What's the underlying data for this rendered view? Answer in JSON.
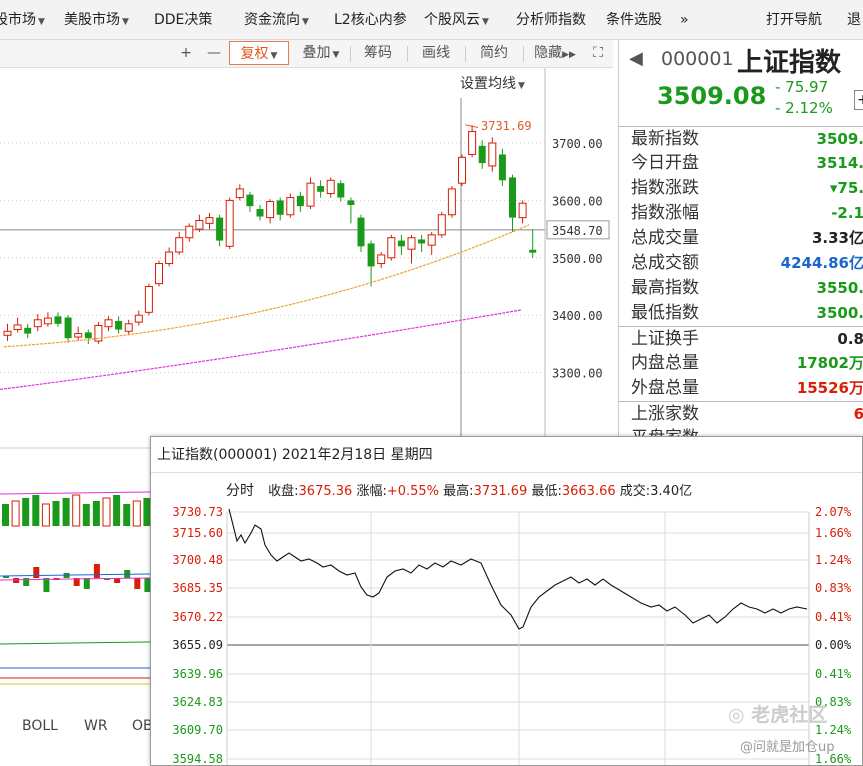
{
  "menu": [
    {
      "label": "股市场",
      "caret": true
    },
    {
      "label": "美股市场",
      "caret": true
    },
    {
      "label": "DDE决策",
      "caret": false
    },
    {
      "label": "资金流向",
      "caret": true
    },
    {
      "label": "L2核心内参",
      "caret": false
    },
    {
      "label": "个股风云",
      "caret": true
    },
    {
      "label": "分析师指数",
      "caret": false
    },
    {
      "label": "条件选股",
      "caret": false
    },
    {
      "label": "»",
      "caret": false
    },
    {
      "label": "打开导航",
      "caret": false
    },
    {
      "label": "退",
      "caret": false
    }
  ],
  "toolbar": {
    "plus": "+",
    "minus": "—",
    "fuquan": "复权",
    "diejia": "叠加",
    "chouma": "筹码",
    "huaxian": "画线",
    "jianyue": "简约",
    "yincang": "隐藏",
    "expand": "⛶"
  },
  "chart": {
    "ma_setting": "设置均线",
    "price_axis": [
      "3700.00",
      "3600.00",
      "3548.70",
      "3500.00",
      "3400.00",
      "3300.00"
    ],
    "high_marker": "3731.69",
    "indicators": [
      "BOLL",
      "WR",
      "OB"
    ]
  },
  "quote": {
    "code": "000001",
    "name": "上证指数",
    "price": "3509.08",
    "change": "- 75.97",
    "change_pct": "- 2.12%",
    "rows": [
      {
        "label": "最新指数",
        "value": "3509.",
        "color": "#1a9a1a"
      },
      {
        "label": "今日开盘",
        "value": "3514.",
        "color": "#1a9a1a"
      },
      {
        "label": "指数涨跌",
        "value": "▾75.",
        "color": "#1a9a1a"
      },
      {
        "label": "指数涨幅",
        "value": "-2.1",
        "color": "#1a9a1a"
      },
      {
        "label": "总成交量",
        "value": "3.33亿",
        "color": "#222222"
      },
      {
        "label": "总成交额",
        "value": "4244.86亿",
        "color": "#1a66cc"
      },
      {
        "label": "最高指数",
        "value": "3550.",
        "color": "#1a9a1a"
      },
      {
        "label": "最低指数",
        "value": "3500.",
        "color": "#1a9a1a"
      },
      {
        "label": "上证换手",
        "value": "0.8",
        "color": "#222222"
      },
      {
        "label": "内盘总量",
        "value": "17802万",
        "color": "#1a9a1a"
      },
      {
        "label": "外盘总量",
        "value": "15526万",
        "color": "#d81e06"
      },
      {
        "label": "上涨家数",
        "value": "6",
        "color": "#d81e06"
      },
      {
        "label": "平盘家数",
        "value": "",
        "color": "#222222"
      }
    ]
  },
  "popup": {
    "title": "上证指数(000001) 2021年2月18日 星期四",
    "tab": "分时",
    "close_label": "收盘:",
    "close_value": "3675.36",
    "change_label": "涨幅:",
    "change_value": "+0.55%",
    "high_label": "最高:",
    "high_value": "3731.69",
    "low_label": "最低:",
    "low_value": "3663.66",
    "vol_label": "成交:",
    "vol_value": "3.40亿",
    "left_ticks": [
      "3730.73",
      "3715.60",
      "3700.48",
      "3685.35",
      "3670.22",
      "3655.09",
      "3639.96",
      "3624.83",
      "3609.70",
      "3594.58"
    ],
    "right_ticks": [
      "2.07%",
      "1.66%",
      "1.24%",
      "0.83%",
      "0.41%",
      "0.00%",
      "0.41%",
      "0.83%",
      "1.24%",
      "1.66%"
    ]
  },
  "watermark": {
    "brand": "老虎社区",
    "user": "@问就是加仓up"
  },
  "colors": {
    "up": "#d81e06",
    "down": "#1a9a1a",
    "accent": "#e05a20"
  }
}
